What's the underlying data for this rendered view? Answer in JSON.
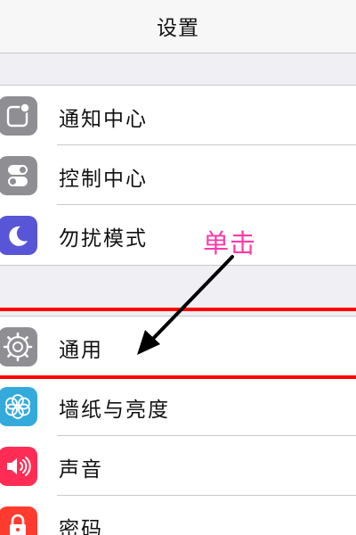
{
  "navbar": {
    "title": "设置"
  },
  "groups": [
    {
      "items": [
        {
          "label": "通知中心",
          "icon": "notification-center-icon",
          "color": "#8e8e93"
        },
        {
          "label": "控制中心",
          "icon": "control-center-icon",
          "color": "#8e8e93"
        },
        {
          "label": "勿扰模式",
          "icon": "moon-icon",
          "color": "#5856d6"
        }
      ]
    },
    {
      "items": [
        {
          "label": "通用",
          "icon": "gear-icon",
          "color": "#8e8e93"
        },
        {
          "label": "墙纸与亮度",
          "icon": "flower-icon",
          "color": "#34aadc"
        },
        {
          "label": "声音",
          "icon": "speaker-icon",
          "color": "#ff2d55"
        },
        {
          "label": "密码",
          "icon": "lock-icon",
          "color": "#ff3b30"
        }
      ]
    }
  ],
  "annotation": {
    "text": "单击",
    "color": "#ff3aa8",
    "highlight_color": "#ff0000"
  }
}
